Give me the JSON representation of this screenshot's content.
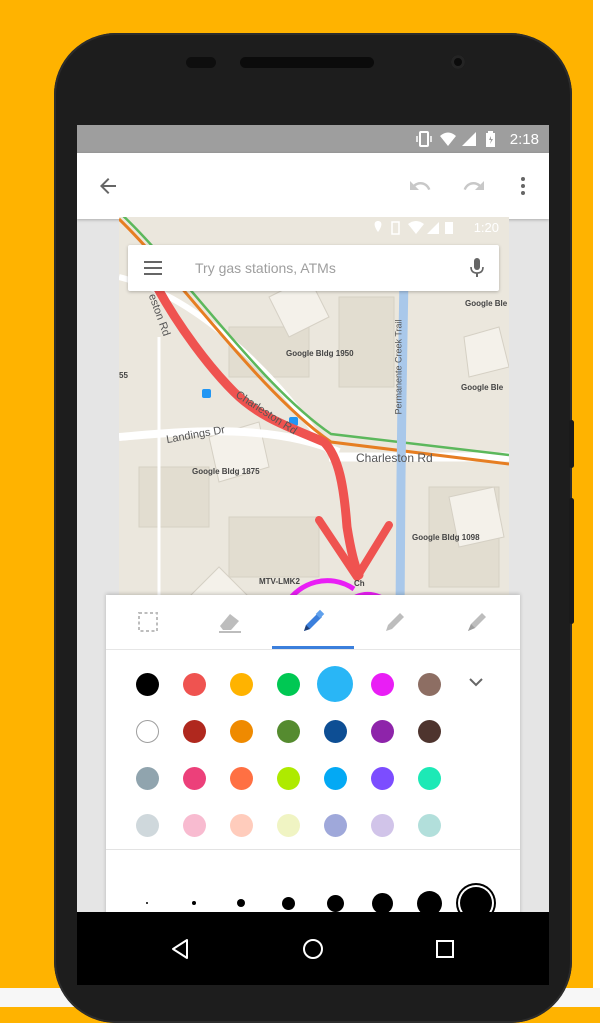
{
  "status_bar": {
    "time": "2:18"
  },
  "app_bar": {
    "back_icon": "arrow-back-icon",
    "undo_icon": "undo-icon",
    "redo_icon": "redo-icon",
    "more_icon": "more-vert-icon"
  },
  "map": {
    "time": "1:20",
    "search_placeholder": "Try gas stations, ATMs",
    "labels": {
      "bldg_1950": "Google Bldg 1950",
      "bldg_1875": "Google Bldg 1875",
      "bldg_1098": "Google Bldg 1098",
      "bldg_right1": "Google Ble",
      "bldg_right2": "Google Ble",
      "mtv": "MTV-LMK2",
      "num": "55",
      "ch": "Ch"
    },
    "streets": {
      "landings": "Landings Dr",
      "charleston_rd": "Charleston Rd",
      "charleston_diag": "Charleston Rd",
      "permanente": "Permanente Creek Trail",
      "upper_left": "eston Rd"
    }
  },
  "tools": {
    "items": [
      "select-icon",
      "eraser-icon",
      "pen-icon",
      "marker-icon",
      "highlighter-icon"
    ],
    "active": "pen-icon"
  },
  "colors": {
    "expand_icon": "chevron-down-icon",
    "selected": "#29B6F6",
    "rows": [
      [
        "#000000",
        "#EF5350",
        "#FFB300",
        "#00C853",
        "#29B6F6",
        "#E91EF5",
        "#8D6E63"
      ],
      [
        "#FFFFFF",
        "#B0281E",
        "#EF8A00",
        "#558B2F",
        "#0D4E94",
        "#8E24AA",
        "#4E342E"
      ],
      [
        "#90A4AE",
        "#EC407A",
        "#FF7043",
        "#AEEA00",
        "#03A9F4",
        "#7C4DFF",
        "#1DE9B6"
      ],
      [
        "#CFD8DC",
        "#F8BBD0",
        "#FFCCBC",
        "#F0F4C3",
        "#9FA8DA",
        "#D1C4E9",
        "#B2DFDB"
      ]
    ]
  },
  "stroke_sizes": {
    "count": 8,
    "selected_index": 7
  },
  "nav_bar": {
    "back": "back-icon",
    "home": "home-icon",
    "recents": "recents-icon"
  }
}
